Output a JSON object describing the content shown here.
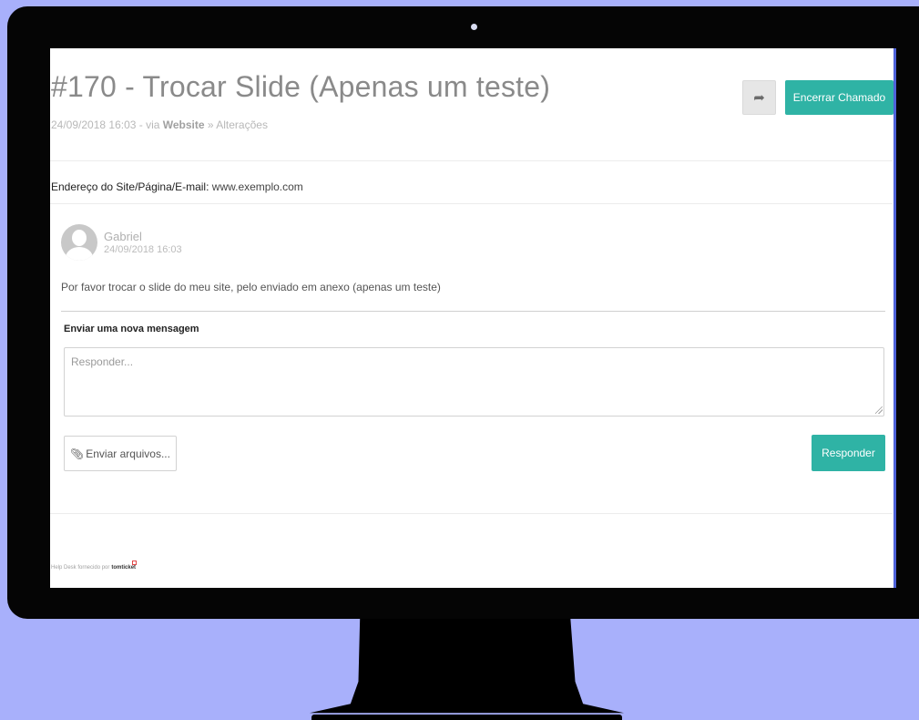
{
  "ticket": {
    "title": "#170 - Trocar Slide (Apenas um teste)",
    "meta_date": "24/09/2018 16:03",
    "meta_via": " - via ",
    "meta_channel": "Website",
    "meta_sep": " » ",
    "meta_category": "Alterações"
  },
  "actions": {
    "forward_icon": "share-arrow-icon",
    "close_label": "Encerrar Chamado"
  },
  "address": {
    "label": "Endereço do Site/Página/E-mail:",
    "value": " www.exemplo.com"
  },
  "message": {
    "author": "Gabriel",
    "date": "24/09/2018 16:03",
    "body": "Por favor trocar o slide do meu site, pelo enviado em anexo (apenas um teste)"
  },
  "reply": {
    "section_label": "Enviar uma nova mensagem",
    "placeholder": "Responder...",
    "attach_icon": "paperclip-icon",
    "attach_label": "Enviar arquivos...",
    "submit_label": "Responder"
  },
  "footer": {
    "text": "Help Desk fornecido por",
    "brand": "tomticket"
  },
  "colors": {
    "accent": "#2fb3a5",
    "background": "#a8b0fb",
    "monitor": "#050505"
  }
}
